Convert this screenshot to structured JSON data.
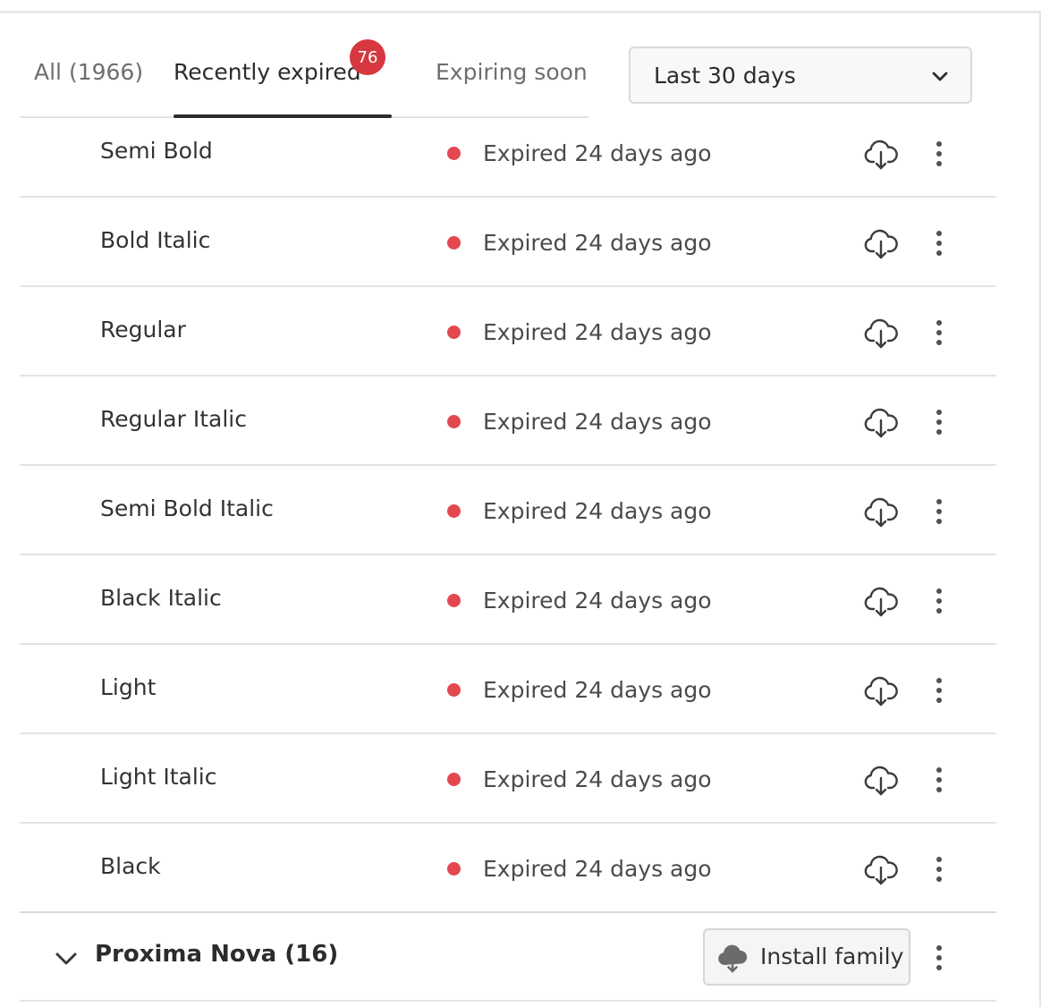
{
  "tabs": [
    {
      "label": "All (1966)",
      "active": false
    },
    {
      "label": "Recently expired",
      "active": true,
      "badge": "76"
    },
    {
      "label": "Expiring soon",
      "active": false
    }
  ],
  "period_select": {
    "value": "Last 30 days",
    "icon": "chevron-down-icon"
  },
  "styles": [
    {
      "name": "Semi Bold",
      "status": "Expired 24 days ago"
    },
    {
      "name": "Bold Italic",
      "status": "Expired 24 days ago"
    },
    {
      "name": "Regular",
      "status": "Expired 24 days ago"
    },
    {
      "name": "Regular Italic",
      "status": "Expired 24 days ago"
    },
    {
      "name": "Semi Bold Italic",
      "status": "Expired 24 days ago"
    },
    {
      "name": "Black Italic",
      "status": "Expired 24 days ago"
    },
    {
      "name": "Light",
      "status": "Expired 24 days ago"
    },
    {
      "name": "Light Italic",
      "status": "Expired 24 days ago"
    },
    {
      "name": "Black",
      "status": "Expired 24 days ago"
    }
  ],
  "row_icons": {
    "download": "cloud-download-icon",
    "more": "more-vertical-icon",
    "status": "status-dot-icon"
  },
  "family": {
    "name": "Proxima Nova (16)",
    "install_label": "Install family",
    "install_icon": "cloud-download-filled-icon"
  },
  "colors": {
    "badge": "#d7373f",
    "expired_dot": "#e34850",
    "text": "#2c2c2c",
    "muted": "#6e6e6e",
    "divider": "#e3e3e3"
  }
}
